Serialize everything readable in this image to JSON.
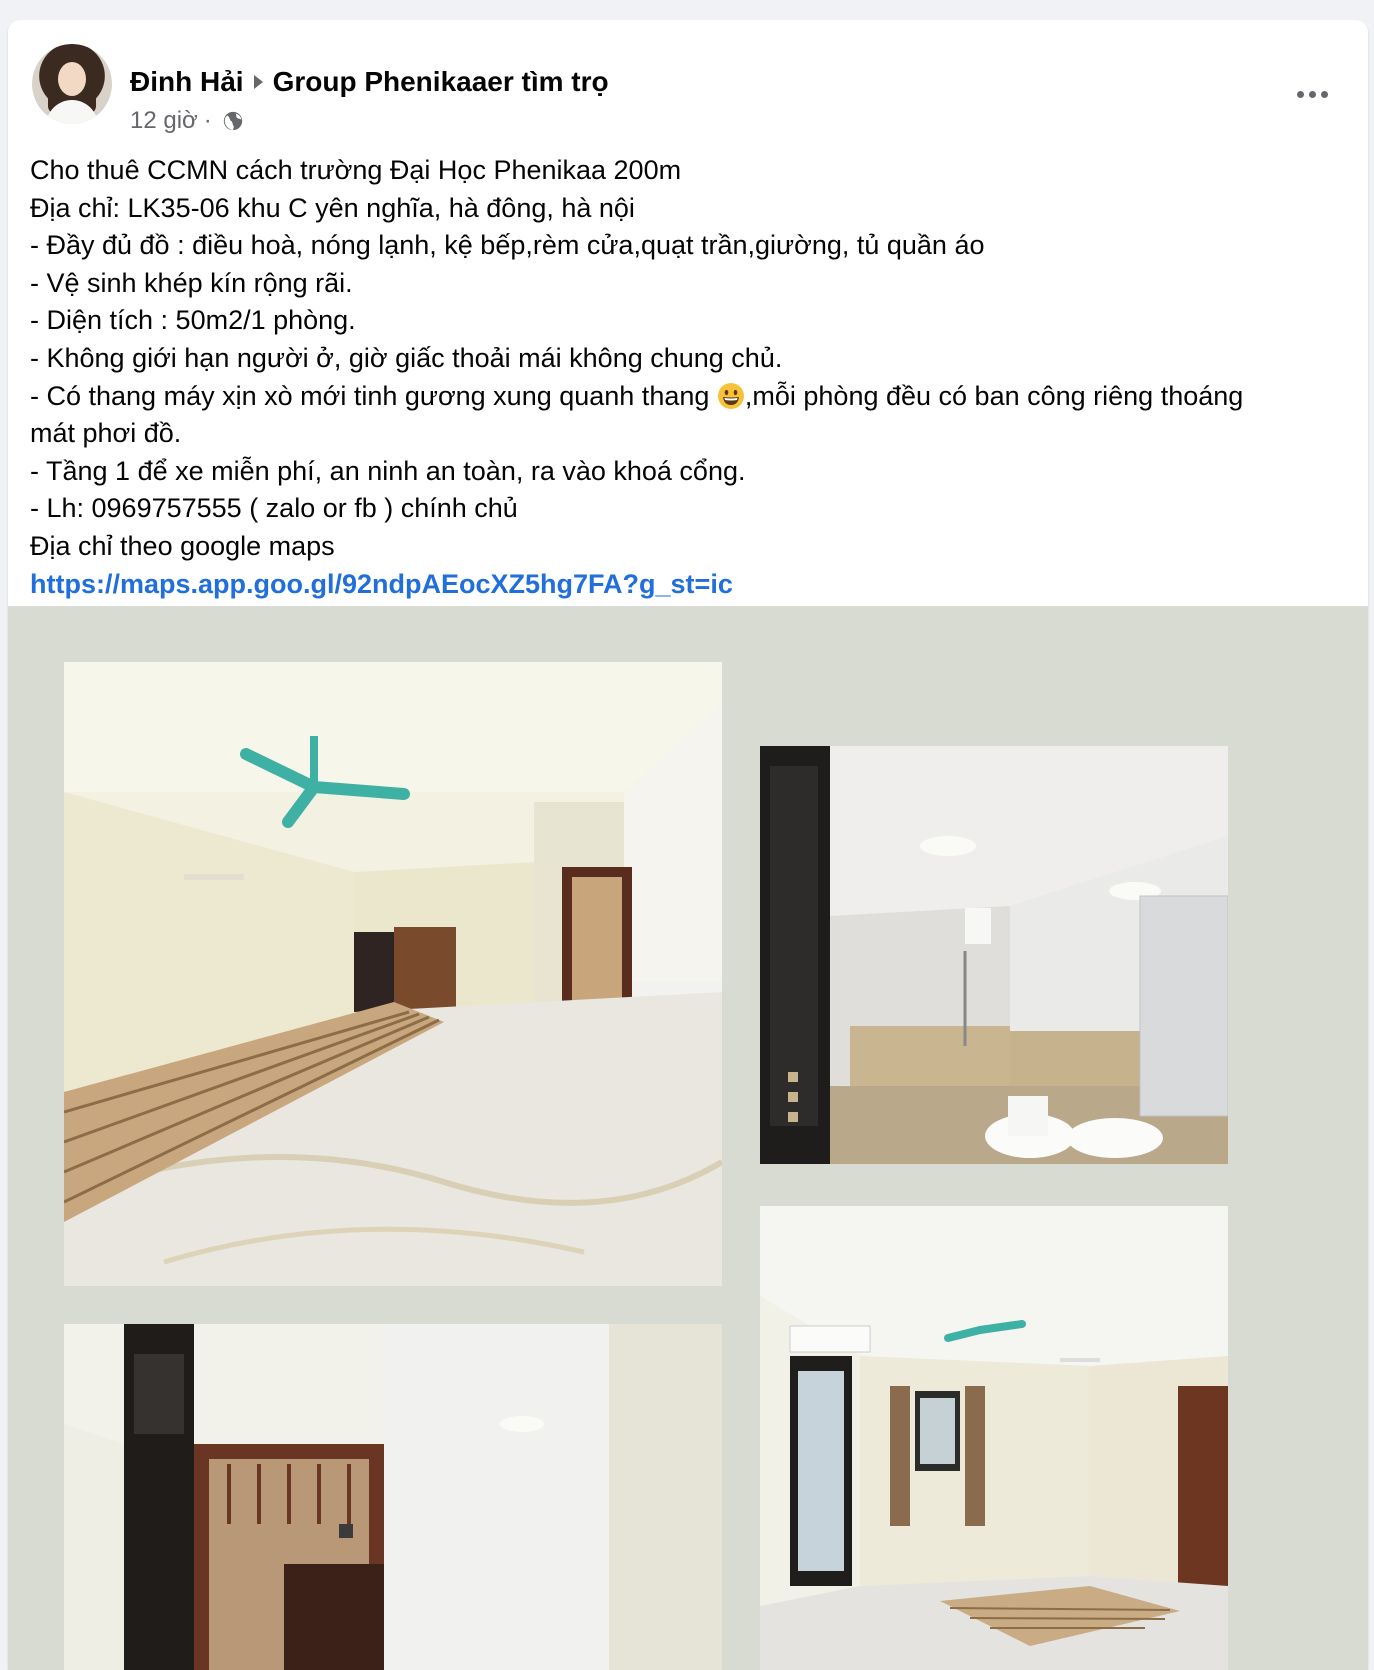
{
  "post": {
    "author": "Đinh Hải",
    "group": "Group Phenikaaer tìm trọ",
    "time": "12 giờ",
    "separator": "·",
    "text_lines": [
      "Cho thuê CCMN cách trường Đại Học Phenikaa 200m",
      "Địa chỉ: LK35-06 khu C yên nghĩa, hà đông, hà nội",
      "- Đầy đủ đồ : điều hoà, nóng lạnh, kệ bếp,rèm cửa,quạt trần,giường, tủ quần áo",
      "- Vệ sinh khép kín rộng rãi.",
      "- Diện tích : 50m2/1 phòng.",
      "- Không giới hạn người ở, giờ giấc thoải mái không chung chủ."
    ],
    "elevator_line_before": "- Có thang máy xịn xò mới tinh gương xung quanh thang ",
    "elevator_line_after": ",mỗi phòng đều có ban công riêng thoáng mát phơi đồ.",
    "text_lines_2": [
      "- Tầng 1 để xe miễn phí, an ninh an toàn, ra vào khoá cổng.",
      "- Lh: 0969757555 ( zalo or fb ) chính chủ",
      "Địa chỉ theo google maps"
    ],
    "link": "https://maps.app.goo.gl/92ndpAEocXZ5hg7FA?g_st=ic"
  },
  "icons": {
    "more": "more-horizontal-icon",
    "privacy": "globe-icon",
    "emoji": "grinning-face-emoji",
    "arrow": "right-arrow-icon"
  },
  "colors": {
    "link": "#216fdb",
    "secondary_text": "#65676b",
    "photo_background": "#d8dbd2"
  },
  "photos": [
    {
      "name": "room-main-photo",
      "subject": "empty room with ceiling fan, wardrobe, pallet bed and kitchen counter"
    },
    {
      "name": "bathroom-photo",
      "subject": "bathroom with shower, toilet, sink and mirror"
    },
    {
      "name": "room-hallway-photo",
      "subject": "room with wall-mounted TV and wooden door"
    },
    {
      "name": "room-balcony-photo",
      "subject": "room with air conditioner, ceiling fan, curtains and balcony door"
    }
  ]
}
